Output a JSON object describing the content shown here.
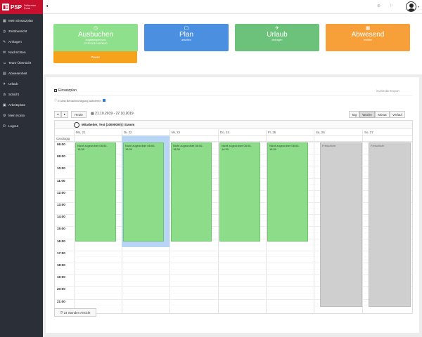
{
  "brand": {
    "short": "PSP",
    "subtitle_line1": "Selfservice",
    "subtitle_line2": "Portal"
  },
  "sidebar": {
    "items": [
      {
        "icon": "calendar-icon",
        "glyph": "▦",
        "label": "Mein Einsatzplan"
      },
      {
        "icon": "clock-icon",
        "glyph": "◷",
        "label": "Zeitübersicht"
      },
      {
        "icon": "pencil-icon",
        "glyph": "✎",
        "label": "Anfragen"
      },
      {
        "icon": "envelope-icon",
        "glyph": "✉",
        "label": "Nachrichten"
      },
      {
        "icon": "users-icon",
        "glyph": "☺",
        "label": "Team-Übersicht"
      },
      {
        "icon": "clipboard-icon",
        "glyph": "▤",
        "label": "Abwesenheit"
      },
      {
        "icon": "plane-icon",
        "glyph": "✈",
        "label": "Urlaub"
      },
      {
        "icon": "clock-icon",
        "glyph": "◷",
        "label": "Schicht"
      },
      {
        "icon": "briefcase-icon",
        "glyph": "▣",
        "label": "Arbeitsplatz"
      },
      {
        "icon": "gear-icon",
        "glyph": "⚙",
        "label": "Mein Konto"
      },
      {
        "icon": "power-icon",
        "glyph": "⏻",
        "label": "Logout"
      }
    ]
  },
  "topbar": {
    "collapse_glyph": "◂",
    "icon1": "⊕",
    "icon2": "⚐",
    "caret": "▾"
  },
  "tiles": [
    {
      "name": "ausbuchen",
      "icon": "◷",
      "title": "Ausbuchen",
      "sub1": "Angestempelt seit:",
      "sub2": "22.10.2019 06:05:00",
      "color": "#8fe08c"
    },
    {
      "name": "plan",
      "icon": "▢",
      "title": "Plan",
      "sub1": "ansehen",
      "sub2": "",
      "color": "#4a8fe0"
    },
    {
      "name": "urlaub",
      "icon": "✈",
      "title": "Urlaub",
      "sub1": "eintragen",
      "sub2": "",
      "color": "#6cc27a"
    },
    {
      "name": "abwesend",
      "icon": "▦",
      "title": "Abwesend",
      "sub1": "melden",
      "sub2": "",
      "color": "#f7a03a"
    }
  ],
  "pause_label": "Pause",
  "einsatzplan": {
    "title": "Einsatzplan",
    "ical_label": "iCalendar Export",
    "email_label": "E-Mail Benachrichtigung aktivieren",
    "today_label": "Heute",
    "date_range": "21.10.2019 - 27.10.2019",
    "views": [
      "Tag",
      "Woche",
      "Monat",
      "Verlauf"
    ],
    "active_view": "Woche",
    "resource_name": "Mitarbeiter, Test (10000000) | Stamm",
    "allday_label": "Ganztägig",
    "days": [
      "Mo, 21",
      "Di, 22",
      "Mi, 23",
      "Do, 24",
      "Fr, 25",
      "Sa, 26",
      "So, 27"
    ],
    "hours": [
      "06:00",
      "09:00",
      "10:00",
      "11:00",
      "12:00",
      "13:00",
      "14:00",
      "15:00",
      "16:00",
      "17:00",
      "18:00",
      "19:00",
      "20:00",
      "21:00"
    ],
    "event_label": "Nicht zugeordnet 08:00-16:30",
    "free_label": "Freischicht",
    "toggle_24h": "24 Stunden Ansicht"
  },
  "colors": {
    "sidebar": "#2b2f38",
    "brand": "#c8102e",
    "event": "#8ddc8a",
    "free": "#cfcfcf",
    "selection": "#b8d5f5"
  }
}
